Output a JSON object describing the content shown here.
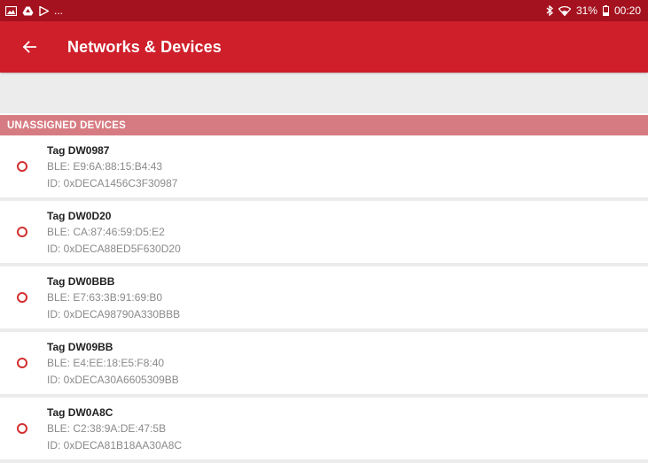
{
  "status_bar": {
    "left_icons": [
      "gallery-icon",
      "drive-icon",
      "play-store-icon"
    ],
    "ellipsis": "...",
    "bluetooth": "bluetooth-icon",
    "wifi": "wifi-icon",
    "battery_text": "31%",
    "time": "00:20"
  },
  "app_bar": {
    "title": "Networks & Devices",
    "back_icon": "arrow-back-icon"
  },
  "section": {
    "header": "UNASSIGNED DEVICES"
  },
  "devices": [
    {
      "name": "Tag DW0987",
      "ble": "BLE: E9:6A:88:15:B4:43",
      "id": "ID: 0xDECA1456C3F30987"
    },
    {
      "name": "Tag DW0D20",
      "ble": "BLE: CA:87:46:59:D5:E2",
      "id": "ID: 0xDECA88ED5F630D20"
    },
    {
      "name": "Tag DW0BBB",
      "ble": "BLE: E7:63:3B:91:69:B0",
      "id": "ID: 0xDECA98790A330BBB"
    },
    {
      "name": "Tag DW09BB",
      "ble": "BLE: E4:EE:18:E5:F8:40",
      "id": "ID: 0xDECA30A6605309BB"
    },
    {
      "name": "Tag DW0A8C",
      "ble": "BLE: C2:38:9A:DE:47:5B",
      "id": "ID: 0xDECA81B18AA30A8C"
    }
  ],
  "colors": {
    "status_bar": "#a5121f",
    "app_bar": "#cf1f2b",
    "section_header": "#d77b82",
    "status_dot": "#d32f2f"
  }
}
